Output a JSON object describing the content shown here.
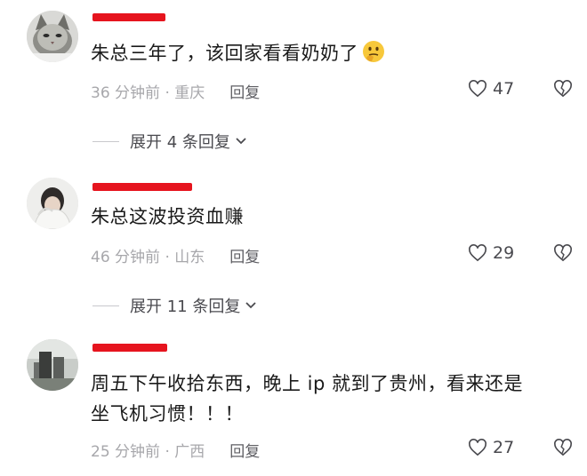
{
  "comments": [
    {
      "text": "朱总三年了，该回家看看奶奶了",
      "time": "36 分钟前",
      "location": "重庆",
      "reply_label": "回复",
      "likes": "47",
      "expand_label": "展开 4 条回复"
    },
    {
      "text": "朱总这波投资血赚",
      "time": "46 分钟前",
      "location": "山东",
      "reply_label": "回复",
      "likes": "29",
      "expand_label": "展开 11 条回复"
    },
    {
      "text_line1": "周五下午收拾东西，晚上 ip 就到了贵州，看来还是",
      "text_line2": "坐飞机习惯！！！",
      "time": "25 分钟前",
      "location": "广西",
      "reply_label": "回复",
      "likes": "27"
    }
  ],
  "separator": " · ",
  "icons": {
    "like": "heart-outline-icon",
    "dislike": "broken-heart-icon",
    "expand": "chevron-down-icon",
    "emoji": "thinking-face-emoji"
  },
  "colors": {
    "redaction": "#e6141e",
    "text": "#1a1a1a",
    "meta": "#a7a7ab"
  }
}
